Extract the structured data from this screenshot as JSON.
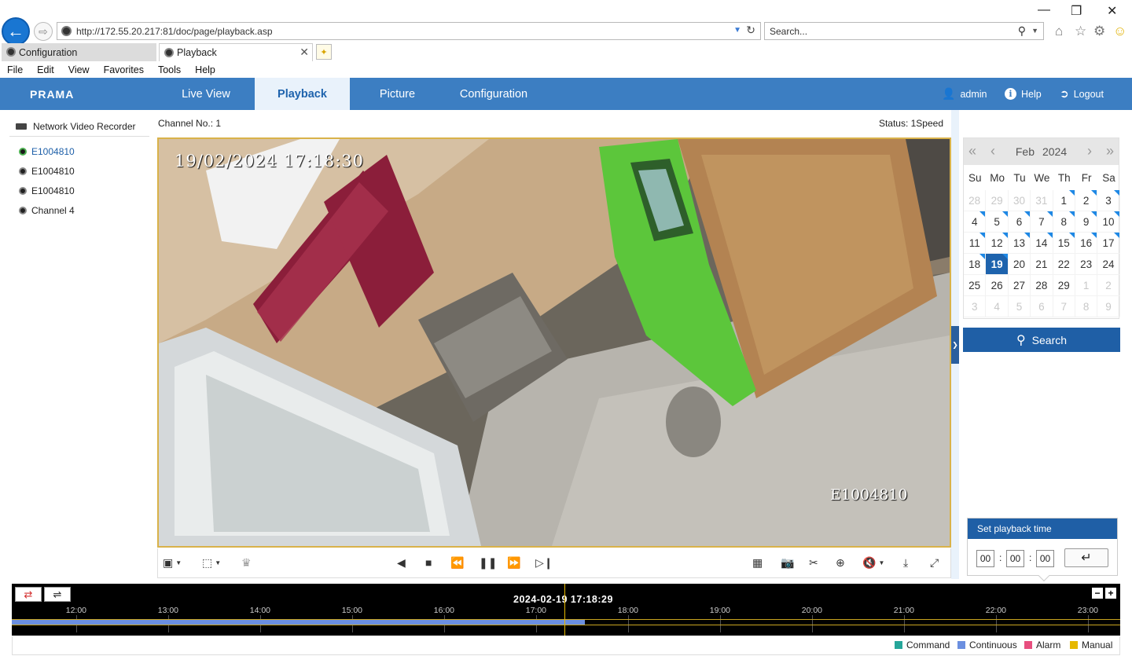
{
  "browser": {
    "url": "http://172.55.20.217:81/doc/page/playback.asp",
    "search_placeholder": "Search...",
    "tabs": [
      {
        "label": "Configuration"
      },
      {
        "label": "Playback"
      }
    ],
    "menu": [
      "File",
      "Edit",
      "View",
      "Favorites",
      "Tools",
      "Help"
    ]
  },
  "app": {
    "logo": "PRAMA",
    "nav": [
      "Live View",
      "Playback",
      "Picture",
      "Configuration"
    ],
    "active_nav": "Playback",
    "user": "admin",
    "help": "Help",
    "logout": "Logout"
  },
  "tree": {
    "root": "Network Video Recorder",
    "channels": [
      "E1004810",
      "E1004810",
      "E1004810",
      "Channel 4"
    ],
    "selected_index": 0
  },
  "player": {
    "channel_label": "Channel No.: 1",
    "status_label": "Status: 1Speed",
    "osd_time": "19/02/2024  17:18:30",
    "osd_name": "E1004810"
  },
  "calendar": {
    "month": "Feb",
    "year": "2024",
    "weekdays": [
      "Su",
      "Mo",
      "Tu",
      "We",
      "Th",
      "Fr",
      "Sa"
    ],
    "days": [
      {
        "d": "28",
        "o": true
      },
      {
        "d": "29",
        "o": true
      },
      {
        "d": "30",
        "o": true
      },
      {
        "d": "31",
        "o": true
      },
      {
        "d": "1",
        "r": true
      },
      {
        "d": "2",
        "r": true
      },
      {
        "d": "3",
        "r": true
      },
      {
        "d": "4",
        "r": true
      },
      {
        "d": "5",
        "r": true
      },
      {
        "d": "6",
        "r": true
      },
      {
        "d": "7",
        "r": true
      },
      {
        "d": "8",
        "r": true
      },
      {
        "d": "9",
        "r": true
      },
      {
        "d": "10",
        "r": true
      },
      {
        "d": "11",
        "r": true
      },
      {
        "d": "12",
        "r": true
      },
      {
        "d": "13",
        "r": true
      },
      {
        "d": "14",
        "r": true
      },
      {
        "d": "15",
        "r": true
      },
      {
        "d": "16",
        "r": true
      },
      {
        "d": "17",
        "r": true
      },
      {
        "d": "18",
        "r": true
      },
      {
        "d": "19",
        "r": true,
        "s": true
      },
      {
        "d": "20"
      },
      {
        "d": "21"
      },
      {
        "d": "22"
      },
      {
        "d": "23"
      },
      {
        "d": "24"
      },
      {
        "d": "25"
      },
      {
        "d": "26"
      },
      {
        "d": "27"
      },
      {
        "d": "28"
      },
      {
        "d": "29"
      },
      {
        "d": "1",
        "o": true
      },
      {
        "d": "2",
        "o": true
      },
      {
        "d": "3",
        "o": true
      },
      {
        "d": "4",
        "o": true
      },
      {
        "d": "5",
        "o": true
      },
      {
        "d": "6",
        "o": true
      },
      {
        "d": "7",
        "o": true
      },
      {
        "d": "8",
        "o": true
      },
      {
        "d": "9",
        "o": true
      }
    ]
  },
  "search_button": "Search",
  "set_time": {
    "title": "Set playback time",
    "hh": "00",
    "mm": "00",
    "ss": "00"
  },
  "timeline": {
    "current": "2024-02-19 17:18:29",
    "hours": [
      "12:00",
      "13:00",
      "14:00",
      "15:00",
      "16:00",
      "17:00",
      "18:00",
      "19:00",
      "20:00",
      "21:00",
      "22:00",
      "23:00"
    ],
    "recording_until_hour": 17.53,
    "cursor_hour": 17.308
  },
  "legend": [
    {
      "label": "Command",
      "color": "#26a69a"
    },
    {
      "label": "Continuous",
      "color": "#6b8fe0"
    },
    {
      "label": "Alarm",
      "color": "#e84f7f"
    },
    {
      "label": "Manual",
      "color": "#e6b800"
    }
  ]
}
